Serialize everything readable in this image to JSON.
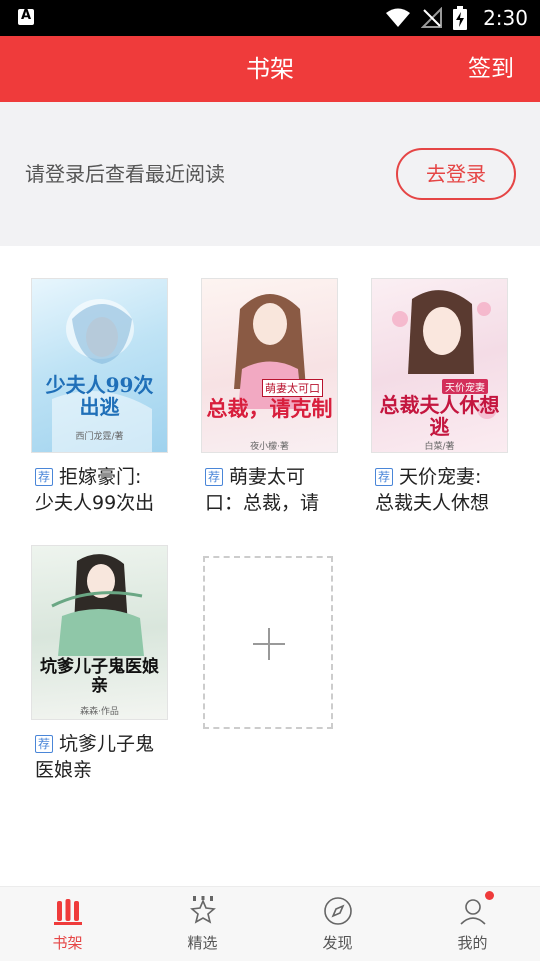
{
  "status_bar": {
    "time": "2:30"
  },
  "header": {
    "title": "书架",
    "checkin_label": "签到"
  },
  "login_prompt": {
    "text": "请登录后查看最近阅读",
    "button_label": "去登录"
  },
  "books": [
    {
      "tag": "荐",
      "title_line1": "拒嫁豪门:",
      "title_line2": "少夫人99次出",
      "cover_title": "少夫人99次出逃",
      "cover_author": "西门龙霆/著"
    },
    {
      "tag": "荐",
      "title_line1": "萌妻太可",
      "title_line2": "口：总裁，请",
      "cover_title": "总裁，请克制",
      "cover_badge": "萌妻太可口",
      "cover_author": "夜小檬·著"
    },
    {
      "tag": "荐",
      "title_line1": "天价宠妻:",
      "title_line2": "总裁夫人休想",
      "cover_title": "总裁夫人休想逃",
      "cover_badge": "天价宠妻",
      "cover_author": "白菜/著"
    },
    {
      "tag": "荐",
      "title_line1": "坑爹儿子鬼",
      "title_line2": "医娘亲",
      "cover_title": "坑爹儿子鬼医娘亲",
      "cover_author": "森森·作品"
    }
  ],
  "bottom_nav": [
    {
      "label": "书架",
      "icon": "bookshelf-icon",
      "active": true
    },
    {
      "label": "精选",
      "icon": "star-icon",
      "active": false
    },
    {
      "label": "发现",
      "icon": "compass-icon",
      "active": false
    },
    {
      "label": "我的",
      "icon": "profile-icon",
      "active": false
    }
  ],
  "colors": {
    "accent": "#ef3b3b",
    "tag": "#4a86d8",
    "panel_bg": "#f2f2f4"
  }
}
